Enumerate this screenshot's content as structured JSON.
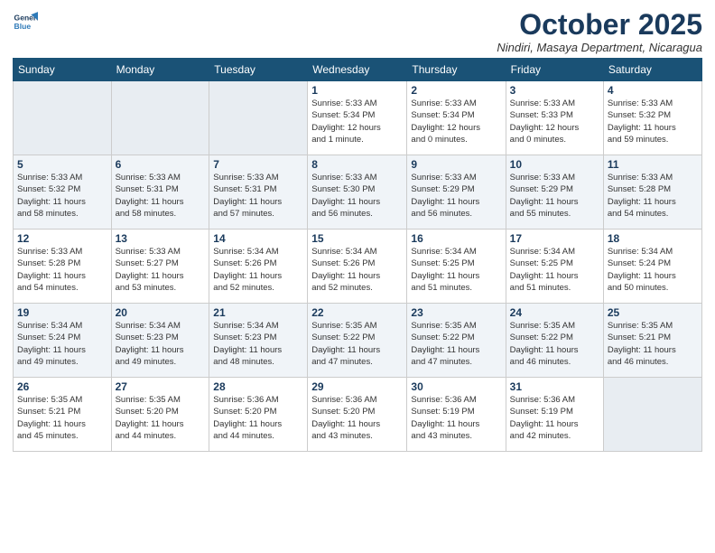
{
  "logo": {
    "line1": "General",
    "line2": "Blue"
  },
  "title": "October 2025",
  "subtitle": "Nindiri, Masaya Department, Nicaragua",
  "days_of_week": [
    "Sunday",
    "Monday",
    "Tuesday",
    "Wednesday",
    "Thursday",
    "Friday",
    "Saturday"
  ],
  "weeks": [
    [
      {
        "day": "",
        "info": ""
      },
      {
        "day": "",
        "info": ""
      },
      {
        "day": "",
        "info": ""
      },
      {
        "day": "1",
        "info": "Sunrise: 5:33 AM\nSunset: 5:34 PM\nDaylight: 12 hours\nand 1 minute."
      },
      {
        "day": "2",
        "info": "Sunrise: 5:33 AM\nSunset: 5:34 PM\nDaylight: 12 hours\nand 0 minutes."
      },
      {
        "day": "3",
        "info": "Sunrise: 5:33 AM\nSunset: 5:33 PM\nDaylight: 12 hours\nand 0 minutes."
      },
      {
        "day": "4",
        "info": "Sunrise: 5:33 AM\nSunset: 5:32 PM\nDaylight: 11 hours\nand 59 minutes."
      }
    ],
    [
      {
        "day": "5",
        "info": "Sunrise: 5:33 AM\nSunset: 5:32 PM\nDaylight: 11 hours\nand 58 minutes."
      },
      {
        "day": "6",
        "info": "Sunrise: 5:33 AM\nSunset: 5:31 PM\nDaylight: 11 hours\nand 58 minutes."
      },
      {
        "day": "7",
        "info": "Sunrise: 5:33 AM\nSunset: 5:31 PM\nDaylight: 11 hours\nand 57 minutes."
      },
      {
        "day": "8",
        "info": "Sunrise: 5:33 AM\nSunset: 5:30 PM\nDaylight: 11 hours\nand 56 minutes."
      },
      {
        "day": "9",
        "info": "Sunrise: 5:33 AM\nSunset: 5:29 PM\nDaylight: 11 hours\nand 56 minutes."
      },
      {
        "day": "10",
        "info": "Sunrise: 5:33 AM\nSunset: 5:29 PM\nDaylight: 11 hours\nand 55 minutes."
      },
      {
        "day": "11",
        "info": "Sunrise: 5:33 AM\nSunset: 5:28 PM\nDaylight: 11 hours\nand 54 minutes."
      }
    ],
    [
      {
        "day": "12",
        "info": "Sunrise: 5:33 AM\nSunset: 5:28 PM\nDaylight: 11 hours\nand 54 minutes."
      },
      {
        "day": "13",
        "info": "Sunrise: 5:33 AM\nSunset: 5:27 PM\nDaylight: 11 hours\nand 53 minutes."
      },
      {
        "day": "14",
        "info": "Sunrise: 5:34 AM\nSunset: 5:26 PM\nDaylight: 11 hours\nand 52 minutes."
      },
      {
        "day": "15",
        "info": "Sunrise: 5:34 AM\nSunset: 5:26 PM\nDaylight: 11 hours\nand 52 minutes."
      },
      {
        "day": "16",
        "info": "Sunrise: 5:34 AM\nSunset: 5:25 PM\nDaylight: 11 hours\nand 51 minutes."
      },
      {
        "day": "17",
        "info": "Sunrise: 5:34 AM\nSunset: 5:25 PM\nDaylight: 11 hours\nand 51 minutes."
      },
      {
        "day": "18",
        "info": "Sunrise: 5:34 AM\nSunset: 5:24 PM\nDaylight: 11 hours\nand 50 minutes."
      }
    ],
    [
      {
        "day": "19",
        "info": "Sunrise: 5:34 AM\nSunset: 5:24 PM\nDaylight: 11 hours\nand 49 minutes."
      },
      {
        "day": "20",
        "info": "Sunrise: 5:34 AM\nSunset: 5:23 PM\nDaylight: 11 hours\nand 49 minutes."
      },
      {
        "day": "21",
        "info": "Sunrise: 5:34 AM\nSunset: 5:23 PM\nDaylight: 11 hours\nand 48 minutes."
      },
      {
        "day": "22",
        "info": "Sunrise: 5:35 AM\nSunset: 5:22 PM\nDaylight: 11 hours\nand 47 minutes."
      },
      {
        "day": "23",
        "info": "Sunrise: 5:35 AM\nSunset: 5:22 PM\nDaylight: 11 hours\nand 47 minutes."
      },
      {
        "day": "24",
        "info": "Sunrise: 5:35 AM\nSunset: 5:22 PM\nDaylight: 11 hours\nand 46 minutes."
      },
      {
        "day": "25",
        "info": "Sunrise: 5:35 AM\nSunset: 5:21 PM\nDaylight: 11 hours\nand 46 minutes."
      }
    ],
    [
      {
        "day": "26",
        "info": "Sunrise: 5:35 AM\nSunset: 5:21 PM\nDaylight: 11 hours\nand 45 minutes."
      },
      {
        "day": "27",
        "info": "Sunrise: 5:35 AM\nSunset: 5:20 PM\nDaylight: 11 hours\nand 44 minutes."
      },
      {
        "day": "28",
        "info": "Sunrise: 5:36 AM\nSunset: 5:20 PM\nDaylight: 11 hours\nand 44 minutes."
      },
      {
        "day": "29",
        "info": "Sunrise: 5:36 AM\nSunset: 5:20 PM\nDaylight: 11 hours\nand 43 minutes."
      },
      {
        "day": "30",
        "info": "Sunrise: 5:36 AM\nSunset: 5:19 PM\nDaylight: 11 hours\nand 43 minutes."
      },
      {
        "day": "31",
        "info": "Sunrise: 5:36 AM\nSunset: 5:19 PM\nDaylight: 11 hours\nand 42 minutes."
      },
      {
        "day": "",
        "info": ""
      }
    ]
  ]
}
